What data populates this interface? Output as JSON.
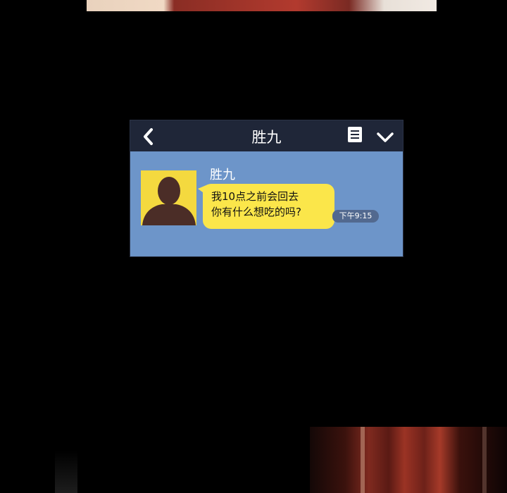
{
  "chat": {
    "title": "胜九",
    "back_icon": "chevron-left-icon",
    "menu_icon": "document-list-icon",
    "collapse_icon": "chevron-down-icon"
  },
  "message": {
    "sender": "胜九",
    "line1": "我10点之前会回去",
    "line2": "你有什么想吃的吗?",
    "time": "下午9:15"
  },
  "colors": {
    "header": "#1f2638",
    "chat_background": "#6d95c9",
    "bubble": "#fbe64a",
    "avatar_background": "#f4d93f"
  }
}
